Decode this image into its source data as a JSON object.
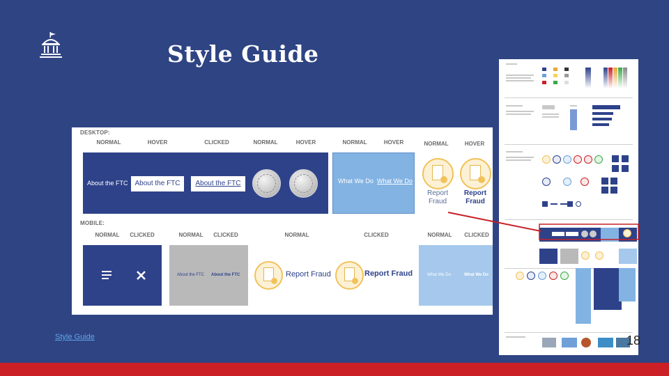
{
  "slide": {
    "title": "Style Guide",
    "footer_link": "Style Guide",
    "page_number": "18"
  },
  "colors": {
    "background": "#2f4483",
    "footer_bar": "#cc2027",
    "navy_button": "#2e428a",
    "light_blue": "#82b3e3",
    "report_yellow": "#f2c25a"
  },
  "desktop": {
    "section_label": "DESKTOP:",
    "columns": [
      "NORMAL",
      "HOVER",
      "CLICKED",
      "NORMAL",
      "HOVER",
      "NORMAL",
      "HOVER",
      "NORMAL",
      "HOVER"
    ],
    "about_normal": "About the FTC",
    "about_hover": "About the FTC",
    "about_clicked": "About the FTC",
    "what_normal": "What We Do",
    "what_hover": "What We Do",
    "report_normal_1": "Report",
    "report_normal_2": "Fraud",
    "report_hover_1": "Report",
    "report_hover_2": "Fraud"
  },
  "mobile": {
    "section_label": "MOBILE:",
    "columns": [
      "NORMAL",
      "CLICKED",
      "NORMAL",
      "CLICKED",
      "NORMAL",
      "CLICKED",
      "NORMAL",
      "CLICKED"
    ],
    "about_normal": "About the FTC",
    "about_clicked": "About the FTC",
    "report_normal": "Report Fraud",
    "report_clicked": "Report Fraud",
    "what_normal": "What We Do",
    "what_clicked": "What We Do",
    "menu_icon": "hamburger-icon",
    "close_icon": "close-icon"
  }
}
